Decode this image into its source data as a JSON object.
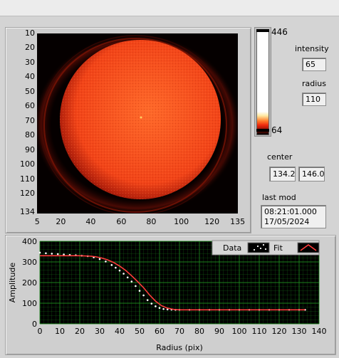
{
  "image_panel": {
    "y_ticks": [
      "10",
      "20",
      "30",
      "40",
      "50",
      "60",
      "70",
      "80",
      "90",
      "100",
      "110",
      "120",
      "134"
    ],
    "x_ticks": [
      "5",
      "20",
      "40",
      "60",
      "80",
      "100",
      "120",
      "135"
    ]
  },
  "colorbar": {
    "max_label": "446",
    "min_label": "64"
  },
  "controls": {
    "intensity_label": "intensity",
    "intensity_value": "65",
    "radius_label": "radius",
    "radius_value": "110",
    "center_label": "center",
    "center_x": "134.2",
    "center_y": "146.0",
    "last_mod_label": "last mod",
    "last_mod_time": "08:21:01.000",
    "last_mod_date": "17/05/2024"
  },
  "legend": {
    "data_label": "Data",
    "fit_label": "Fit"
  },
  "colors": {
    "fit": "#ff3b3b",
    "data": "#ffffff",
    "plot_bg": "#000000",
    "grid": "#1f8a1f"
  },
  "chart_data": {
    "type": "scatter",
    "xlabel": "Radius (pix)",
    "ylabel": "Amplitude",
    "xlim": [
      0,
      140
    ],
    "ylim": [
      0,
      400
    ],
    "x_ticks": [
      "0",
      "10",
      "20",
      "30",
      "40",
      "50",
      "60",
      "70",
      "80",
      "90",
      "100",
      "110",
      "120",
      "130",
      "140"
    ],
    "y_ticks": [
      "0",
      "100",
      "200",
      "300",
      "400"
    ],
    "series": [
      {
        "name": "Data",
        "x": [
          0,
          3,
          6,
          9,
          12,
          15,
          18,
          21,
          24,
          27,
          30,
          33,
          36,
          38,
          40,
          42,
          44,
          46,
          48,
          50,
          52,
          54,
          56,
          58,
          60,
          62,
          64,
          66,
          68,
          70,
          75,
          80,
          85,
          90,
          95,
          100,
          105,
          110,
          115,
          120,
          125,
          130,
          133
        ],
        "y": [
          345,
          342,
          340,
          338,
          336,
          334,
          332,
          330,
          328,
          322,
          314,
          302,
          285,
          272,
          258,
          243,
          225,
          205,
          183,
          160,
          138,
          115,
          98,
          85,
          77,
          72,
          70,
          69,
          68,
          68,
          68,
          68,
          68,
          68,
          68,
          68,
          68,
          68,
          68,
          68,
          68,
          68,
          68
        ]
      },
      {
        "name": "Fit",
        "x": [
          0,
          5,
          10,
          15,
          20,
          25,
          28,
          31,
          34,
          37,
          40,
          43,
          46,
          49,
          52,
          55,
          58,
          61,
          64,
          67,
          70,
          75,
          80,
          90,
          100,
          110,
          120,
          133
        ],
        "y": [
          330,
          330,
          330,
          330,
          330,
          328,
          325,
          319,
          310,
          297,
          280,
          259,
          233,
          205,
          175,
          140,
          110,
          88,
          76,
          70,
          68,
          68,
          68,
          68,
          68,
          68,
          68,
          68
        ]
      }
    ]
  }
}
